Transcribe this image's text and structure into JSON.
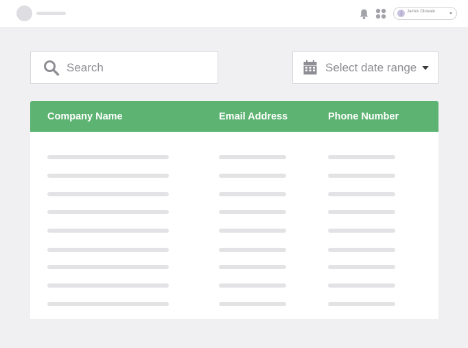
{
  "topbar": {
    "user_name": "James Oluwale",
    "icons": [
      "logo-placeholder",
      "bell-icon",
      "apps-icon",
      "chevron-down-icon"
    ]
  },
  "search": {
    "placeholder": "Search",
    "value": ""
  },
  "date_filter": {
    "label": "Select date range"
  },
  "table": {
    "columns": [
      "Company Name",
      "Email Address",
      "Phone Number"
    ],
    "row_count": 9,
    "state": "loading"
  },
  "colors": {
    "header_green": "#5db372",
    "background": "#f0f0f2",
    "skeleton": "#e3e3e6"
  }
}
